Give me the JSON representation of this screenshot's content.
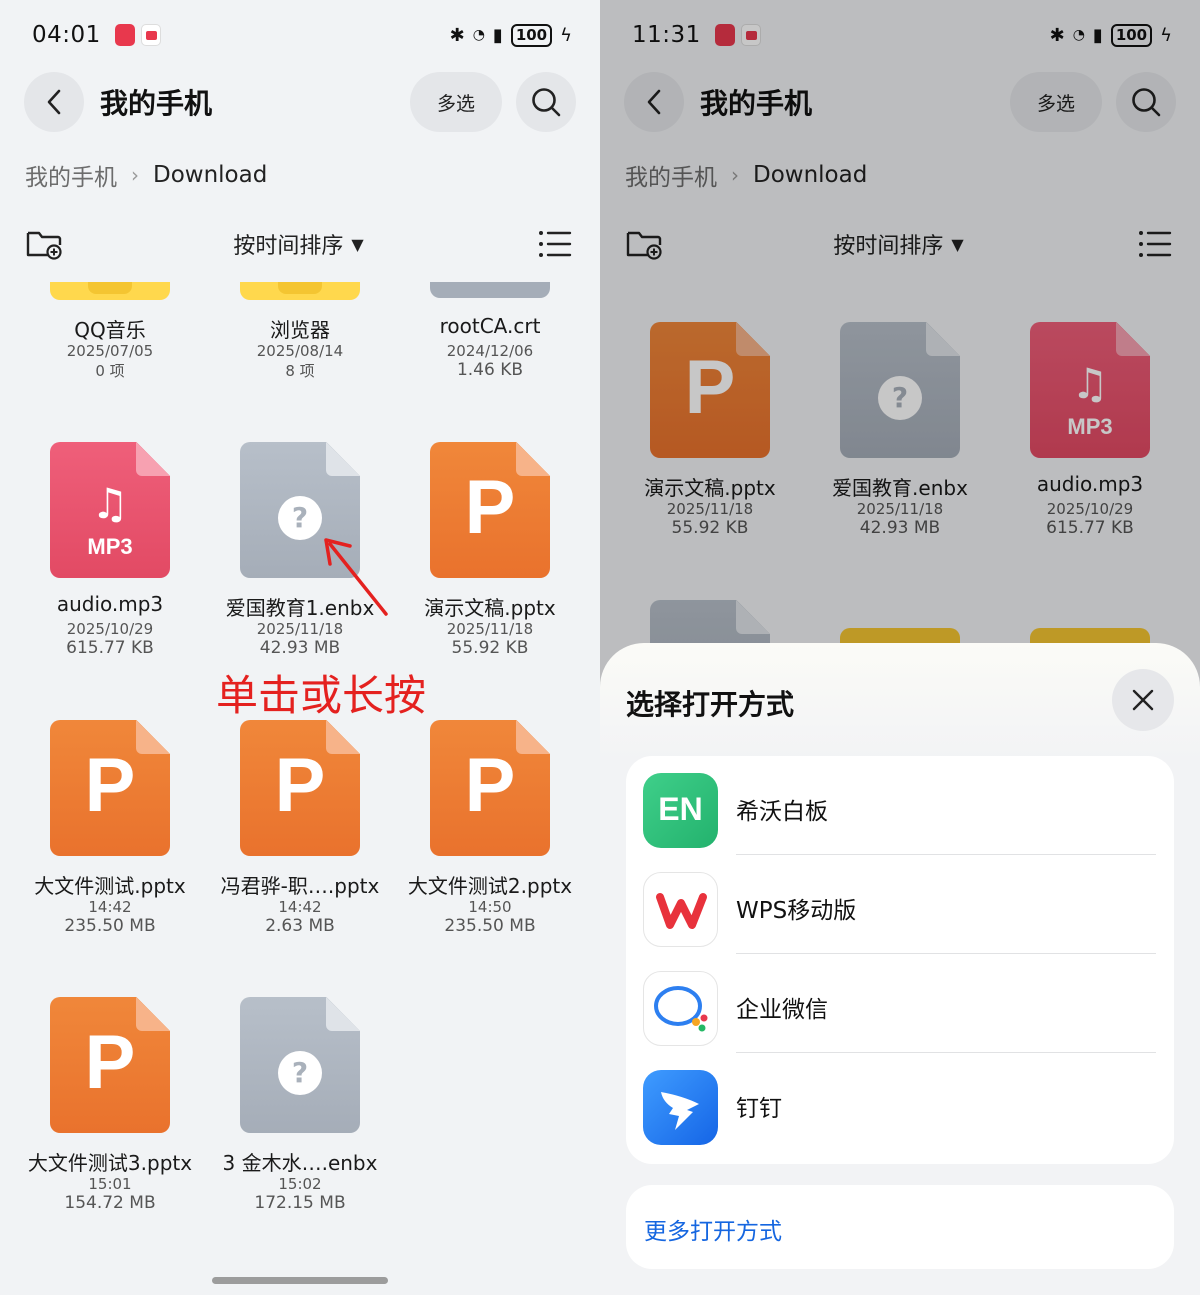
{
  "left": {
    "status": {
      "time": "04:01",
      "battery": "100"
    },
    "header": {
      "title": "我的手机",
      "multi_select": "多选"
    },
    "breadcrumb": {
      "root": "我的手机",
      "current": "Download"
    },
    "toolbar": {
      "sort_label": "按时间排序"
    },
    "files": [
      {
        "name": "QQ音乐",
        "date": "2025/07/05",
        "size": "0 项",
        "kind": "folder"
      },
      {
        "name": "浏览器",
        "date": "2025/08/14",
        "size": "8 项",
        "kind": "folder"
      },
      {
        "name": "rootCA.crt",
        "date": "2024/12/06",
        "size": "1.46 KB",
        "kind": "crt"
      },
      {
        "name": "audio.mp3",
        "date": "2025/10/29",
        "size": "615.77 KB",
        "kind": "mp3"
      },
      {
        "name": "爱国教育1.enbx",
        "date": "2025/11/18",
        "size": "42.93 MB",
        "kind": "unknown"
      },
      {
        "name": "演示文稿.pptx",
        "date": "2025/11/18",
        "size": "55.92 KB",
        "kind": "pptx"
      },
      {
        "name": "大文件测试.pptx",
        "date": "14:42",
        "size": "235.50 MB",
        "kind": "pptx"
      },
      {
        "name": "冯君骅-职….pptx",
        "date": "14:42",
        "size": "2.63 MB",
        "kind": "pptx"
      },
      {
        "name": "大文件测试2.pptx",
        "date": "14:50",
        "size": "235.50 MB",
        "kind": "pptx"
      },
      {
        "name": "大文件测试3.pptx",
        "date": "15:01",
        "size": "154.72 MB",
        "kind": "pptx"
      },
      {
        "name": "3 金木水….enbx",
        "date": "15:02",
        "size": "172.15 MB",
        "kind": "unknown"
      }
    ],
    "annotation": "单击或长按"
  },
  "right": {
    "status": {
      "time": "11:31",
      "battery": "100"
    },
    "header": {
      "title": "我的手机",
      "multi_select": "多选"
    },
    "breadcrumb": {
      "root": "我的手机",
      "current": "Download"
    },
    "toolbar": {
      "sort_label": "按时间排序"
    },
    "files": [
      {
        "name": "演示文稿.pptx",
        "date": "2025/11/18",
        "size": "55.92 KB",
        "kind": "pptx"
      },
      {
        "name": "爱国教育.enbx",
        "date": "2025/11/18",
        "size": "42.93 MB",
        "kind": "unknown"
      },
      {
        "name": "audio.mp3",
        "date": "2025/10/29",
        "size": "615.77 KB",
        "kind": "mp3"
      }
    ],
    "sheet": {
      "title": "选择打开方式",
      "apps": [
        {
          "name": "希沃白板",
          "icon_text": "EN",
          "icon": "seewo-whiteboard-icon"
        },
        {
          "name": "WPS移动版",
          "icon": "wps-icon"
        },
        {
          "name": "企业微信",
          "icon": "wecom-icon"
        },
        {
          "name": "钉钉",
          "icon": "dingtalk-icon"
        }
      ],
      "more": "更多打开方式"
    }
  },
  "icons": {
    "mp3_label": "MP3",
    "pptx_glyph": "P",
    "unknown_glyph": "?"
  },
  "colors": {
    "pptx": "#e9722d",
    "mp3": "#e24a64",
    "unknown": "#a5adb8",
    "folder": "#ffd84d",
    "link": "#1566e0",
    "annotation": "#e4211f"
  }
}
